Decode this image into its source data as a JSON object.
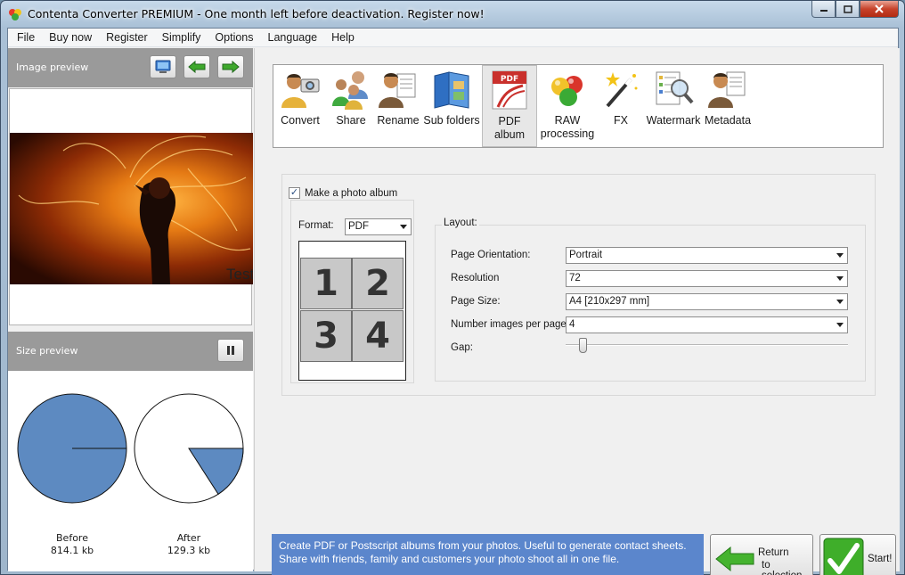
{
  "window": {
    "title": "Contenta Converter PREMIUM  - One month left before deactivation. Register now!"
  },
  "menu": [
    "File",
    "Buy now",
    "Register",
    "Simplify",
    "Options",
    "Language",
    "Help"
  ],
  "left_panel": {
    "image_preview_label": "Image preview",
    "photo_watermark": "Test",
    "size_preview_label": "Size preview",
    "before": {
      "label": "Before",
      "size": "814.1 kb"
    },
    "after": {
      "label": "After",
      "size": "129.3 kb"
    },
    "after_ratio": 0.159
  },
  "toolbar": {
    "items": [
      {
        "label": "Convert",
        "icon": "user-camera-icon"
      },
      {
        "label": "Share",
        "icon": "users-share-icon"
      },
      {
        "label": "Rename",
        "icon": "user-document-icon"
      },
      {
        "label": "Sub folders",
        "icon": "folder-book-icon"
      },
      {
        "label": "PDF album",
        "icon": "pdf-icon",
        "active": true
      },
      {
        "label": "RAW processing",
        "icon": "color-balls-icon"
      },
      {
        "label": "FX",
        "icon": "magic-wand-icon"
      },
      {
        "label": "Watermark",
        "icon": "magnifier-document-icon"
      },
      {
        "label": "Metadata",
        "icon": "user-doc-metadata-icon"
      }
    ],
    "pdf_icon_text": "PDF"
  },
  "album": {
    "make_album_label": "Make a photo album",
    "make_album_checked": true,
    "format_label": "Format:",
    "format_value": "PDF",
    "grid_numbers": [
      "1",
      "2",
      "3",
      "4"
    ],
    "layout_label": "Layout:",
    "fields": {
      "orientation": {
        "label": "Page Orientation:",
        "value": "Portrait"
      },
      "resolution": {
        "label": "Resolution",
        "value": "72"
      },
      "page_size": {
        "label": "Page Size:",
        "value": "A4 [210x297 mm]"
      },
      "images_per_page": {
        "label": "Number images per page:",
        "value": "4"
      },
      "gap": {
        "label": "Gap:",
        "value_fraction": 0.05
      }
    }
  },
  "footer": {
    "description": "Create PDF or Postscript albums from your photos. Useful to generate contact sheets. Share with friends, family and customers your photo shoot all in one file.",
    "return_line1": "Return",
    "return_line2": "to selection",
    "start_label": "Start!"
  },
  "colors": {
    "pie_fill": "#5d8ac1",
    "description_bg": "#5b86cc",
    "start_green": "#3fae2a"
  }
}
